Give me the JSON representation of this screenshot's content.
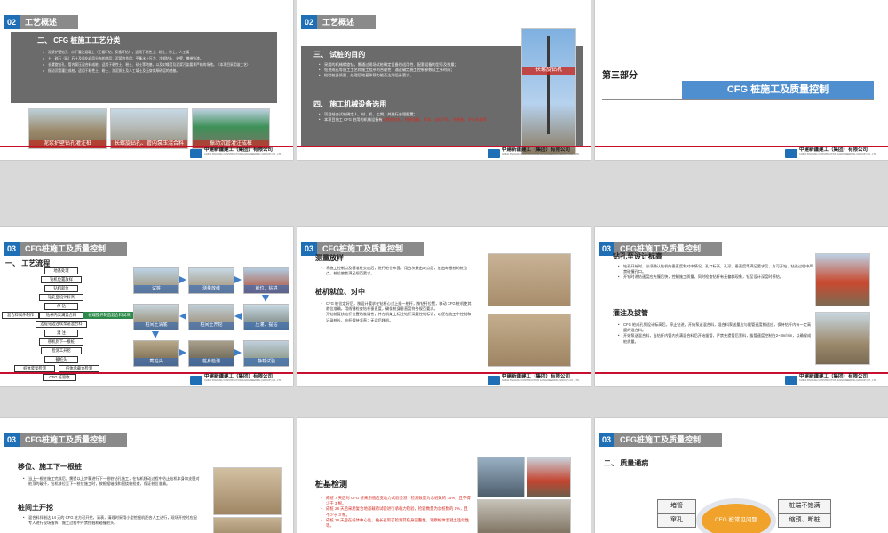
{
  "company": {
    "name_cn": "中建新疆建工（集团）有限公司",
    "name_en": "CHINA XINJIANG CONSTRUCTION & ENGINEERING (GROUP) CO., LTD."
  },
  "colors": {
    "section_blue": "#1f6fb6",
    "header_gray": "#8a8a8a",
    "footer_red": "#c8102e",
    "title_blue": "#4f8fd0"
  },
  "slides": [
    {
      "num": "02",
      "section": "工艺概述",
      "heading": "二、 CFG 桩施工工艺分类",
      "bullets": [
        "泥浆护壁钻孔 · 水下灌注混凝土（正循环钻、反循环钻），适用于粘性土、粉土、砂土、人工填",
        "土、碎石（砾）石土及风化岩层分布的地层；泥浆的作用：平衡水土压力、冷却钻头、护壁、携带钻渣。",
        "长螺旋钻孔、管内泵压混合料成桩，适用于粘性土、粉土、砂土等地基，以及对噪音及泥浆污染要求严格的场地。（本项目采用该工艺）",
        "振动沉管灌注成桩，适用于粘性土、粉土、淤泥质土及人工填土及无穿实厚砂层的地基。"
      ],
      "photos": [
        "泥浆护壁钻孔灌注桩",
        "长螺旋钻孔、管内泵压混合料",
        "振动沉管灌注成桩"
      ]
    },
    {
      "num": "02",
      "section": "工艺概述",
      "heading3": "三、 试桩的目的",
      "bullets3": [
        "采用的机械螺旋钻，需通过现场试桩确定设备的适用性、配套设备的型号及数量；",
        "钻进成孔等施工工艺和施工程序的合理性，通过确定施工控制参数及工序时间；",
        "检验桩身质量、处理后地基承载力能否达到设计要求。"
      ],
      "heading4": "四、 施工机械设备选用",
      "bullets4": [
        "项目结合试桩确定人、材、机、工期，并进行合理配置；",
        "本项目施工 CFG 桩用的机械设备有"
      ],
      "equipment": "长螺旋钻机、挖掘设备、泵车、自卸汽车、挖掘机、铲斗机械等",
      "photo_caption": "长螺旋钻机"
    },
    {
      "part": "第三部分",
      "title": "CFG 桩施工及质量控制"
    },
    {
      "num": "03",
      "section": "CFG桩施工及质量控制",
      "heading": "一、 工艺流程",
      "flow": [
        "地基处理",
        "钻机位置放样",
        "钻机就位",
        "钻孔至设计标高",
        "停  钻",
        "混合料试件制作",
        "钻杆内泵满混合料",
        "边提钻边连续泵送混合料",
        "边提钻杆边泵混合料达到桩顶",
        "灌  注",
        "移机到下一根桩",
        "检测工开挖",
        "移机至下一根桩",
        "截桩头",
        "检测",
        "桩体浆泵检测",
        "桩体承载力检测",
        "CFG 桩验收"
      ],
      "flow_highlight": "桩端搅拌制造混合料试块",
      "photos": [
        "试桩",
        "测量放线",
        "就位、钻进",
        "桩间土清底",
        "桩间土开挖",
        "压灌、提钻",
        "截桩头",
        "桩身检测",
        "静载试验"
      ]
    },
    {
      "num": "03",
      "section": "CFG桩施工及质量控制",
      "heading1": "测量放样",
      "bullets1": [
        "将施工控制点及基准桩交底后，进行桩位布置，用白灰撒出灰点后，放出每根桩的桩位点，桩位偏差满足规范要求。"
      ],
      "heading2": "桩机就位、对中",
      "bullets2": [
        "CFG 桩位定好后，按设计要求在钻杆心对上插一根杆，按钻杆位置，移动 CFG 桩机使其就位准确，用线锤检查钻杆垂直度，确保桩身垂直度符合规范要求。",
        "开钻前复核钻杆位置的准确性，并在机架上标注钻杆深度控制标识，以便在施工中控制和记录桩长，钻杆保持竖直；无误后移机。"
      ]
    },
    {
      "num": "03",
      "section": "CFG桩施工及质量控制",
      "heading1": "钻孔至设计标高",
      "bullets1": [
        "钻孔开始时，必须确认钻机的垂直度和对中情况，孔口标高，孔深、垂直度等满足要求后，方可开钻，钻进过程中严禁碰撞孔口。",
        "开钻时进钻速度应先慢后快，控制施工质量，同时检查钻杆有无偏斜现象，钻至设计深度时停钻。"
      ],
      "heading2": "灌注及拔管",
      "bullets2": [
        "CFG 桩成孔到设计标高后，停止钻进，开始泵送混合料，混合料泵送量应与拔管速度相适应，保持钻杆内有一定高度的混合料。",
        "开始泵送混合料，当钻杆内管内充满混合料后开始拔管，严禁先提管后泵料，拔管速度控制在2~3m/min，以确保成桩质量。"
      ]
    },
    {
      "num": "03",
      "section": "CFG桩施工及质量控制",
      "heading1": "移位、施工下一根桩",
      "bullets1": [
        "当上一根桩施工完成后，需提以上步骤进行下一根桩钻孔施工，在钻机移动过程中防止钻机车身和支腿对桩顶的破坏，钻机移位至下一桩位施工时，按根据轴线和围绕桩检查，保证桩位准确。"
      ],
      "heading2": "桩间土开挖",
      "bullets2": [
        "混合料拌制达 14 天的 CFG 桩方可开挖，清表，清理时采用小型挖掘机配合人工进行，现场开挖时应配专人进行现场指挥，施工过程中严禁挖掘机碰撞桩头。"
      ]
    },
    {
      "num": "",
      "section": "",
      "heading": "桩基检测",
      "lines": [
        "成桩 7 天后对 CFG 桩采用低应变动力试验检测，检测数量为总桩数的 10%，且不得少于 3 根。",
        "成桩 28 天后采用复合地基载荷试验进行承载力检验，检验数量为总桩数的 1%，且不少于 3 根。",
        "成桩 28 天后在桩体中心处，抽长孔取芯检测其桩身完整性，观察桩体混凝土连续性等。"
      ]
    },
    {
      "num": "03",
      "section": "CFG桩施工及质量控制",
      "heading": "二、 质量通病",
      "left": [
        "堵管",
        "窜孔"
      ],
      "center": "CFG 桩常见问题",
      "right": [
        "桩端不饱满",
        "缩颈、断桩"
      ]
    }
  ]
}
